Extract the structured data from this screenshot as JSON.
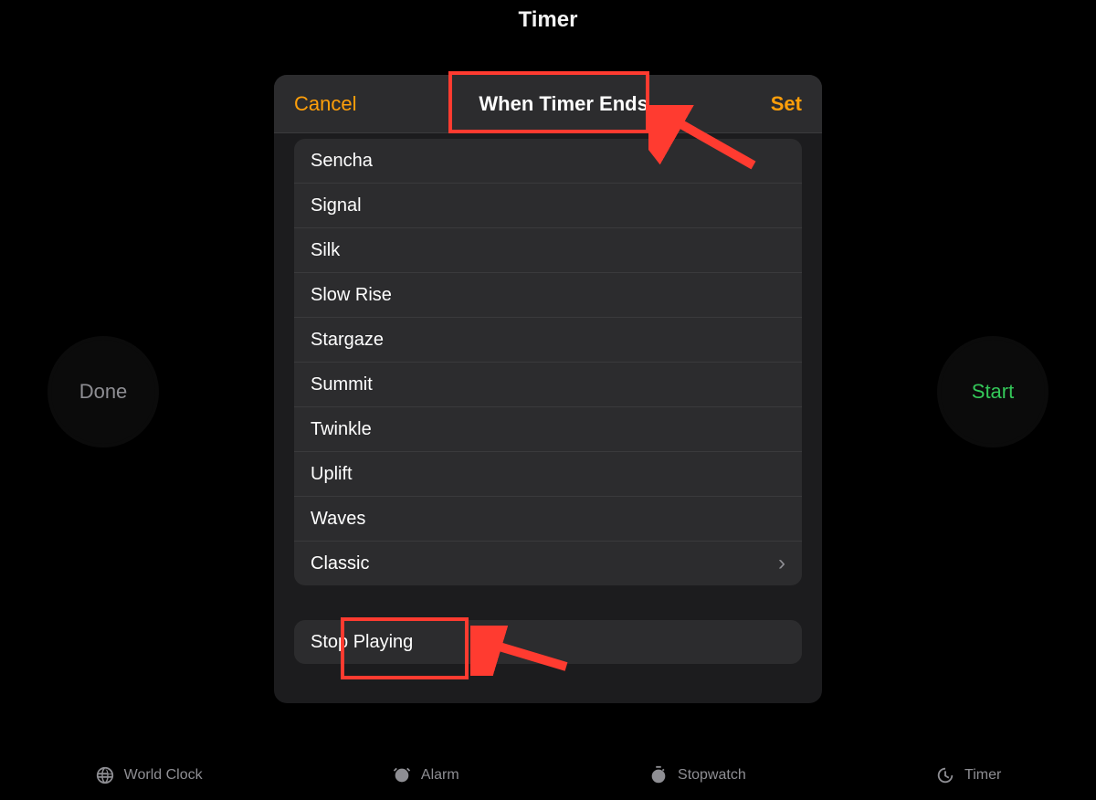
{
  "page_title": "Timer",
  "left_button": "Done",
  "right_button": "Start",
  "modal": {
    "cancel": "Cancel",
    "title": "When Timer Ends",
    "set": "Set",
    "sounds": [
      "Sencha",
      "Signal",
      "Silk",
      "Slow Rise",
      "Stargaze",
      "Summit",
      "Twinkle",
      "Uplift",
      "Waves",
      "Classic"
    ],
    "classic_has_chevron": true,
    "stop_playing": "Stop Playing"
  },
  "tabs": {
    "world_clock": "World Clock",
    "alarm": "Alarm",
    "stopwatch": "Stopwatch",
    "timer": "Timer"
  },
  "colors": {
    "accent_orange": "#ff9f0a",
    "start_green": "#34c759",
    "annotation_red": "#ff3b30"
  }
}
